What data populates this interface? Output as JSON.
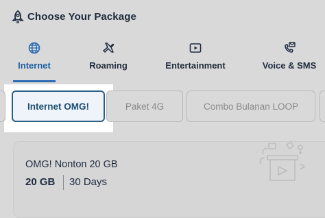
{
  "header": {
    "title": "Choose Your Package",
    "icon": "rocket-icon"
  },
  "tabs": [
    {
      "label": "Internet",
      "icon": "globe-icon",
      "active": true
    },
    {
      "label": "Roaming",
      "icon": "airplane-icon",
      "active": false
    },
    {
      "label": "Entertainment",
      "icon": "play-icon",
      "active": false
    },
    {
      "label": "Voice & SMS",
      "icon": "phone-message-icon",
      "active": false
    }
  ],
  "chips": [
    {
      "label": "Internet OMG!",
      "selected": true
    },
    {
      "label": "Paket 4G",
      "selected": false
    },
    {
      "label": "Combo Bulanan LOOP",
      "selected": false
    }
  ],
  "package": {
    "name": "OMG! Nonton 20 GB",
    "quota": "20 GB",
    "duration": "30 Days"
  },
  "colors": {
    "accent": "#2a6bb3",
    "selected_border": "#2a5f86",
    "text": "#1f2b3d",
    "overlay": "#d9d9d9"
  }
}
